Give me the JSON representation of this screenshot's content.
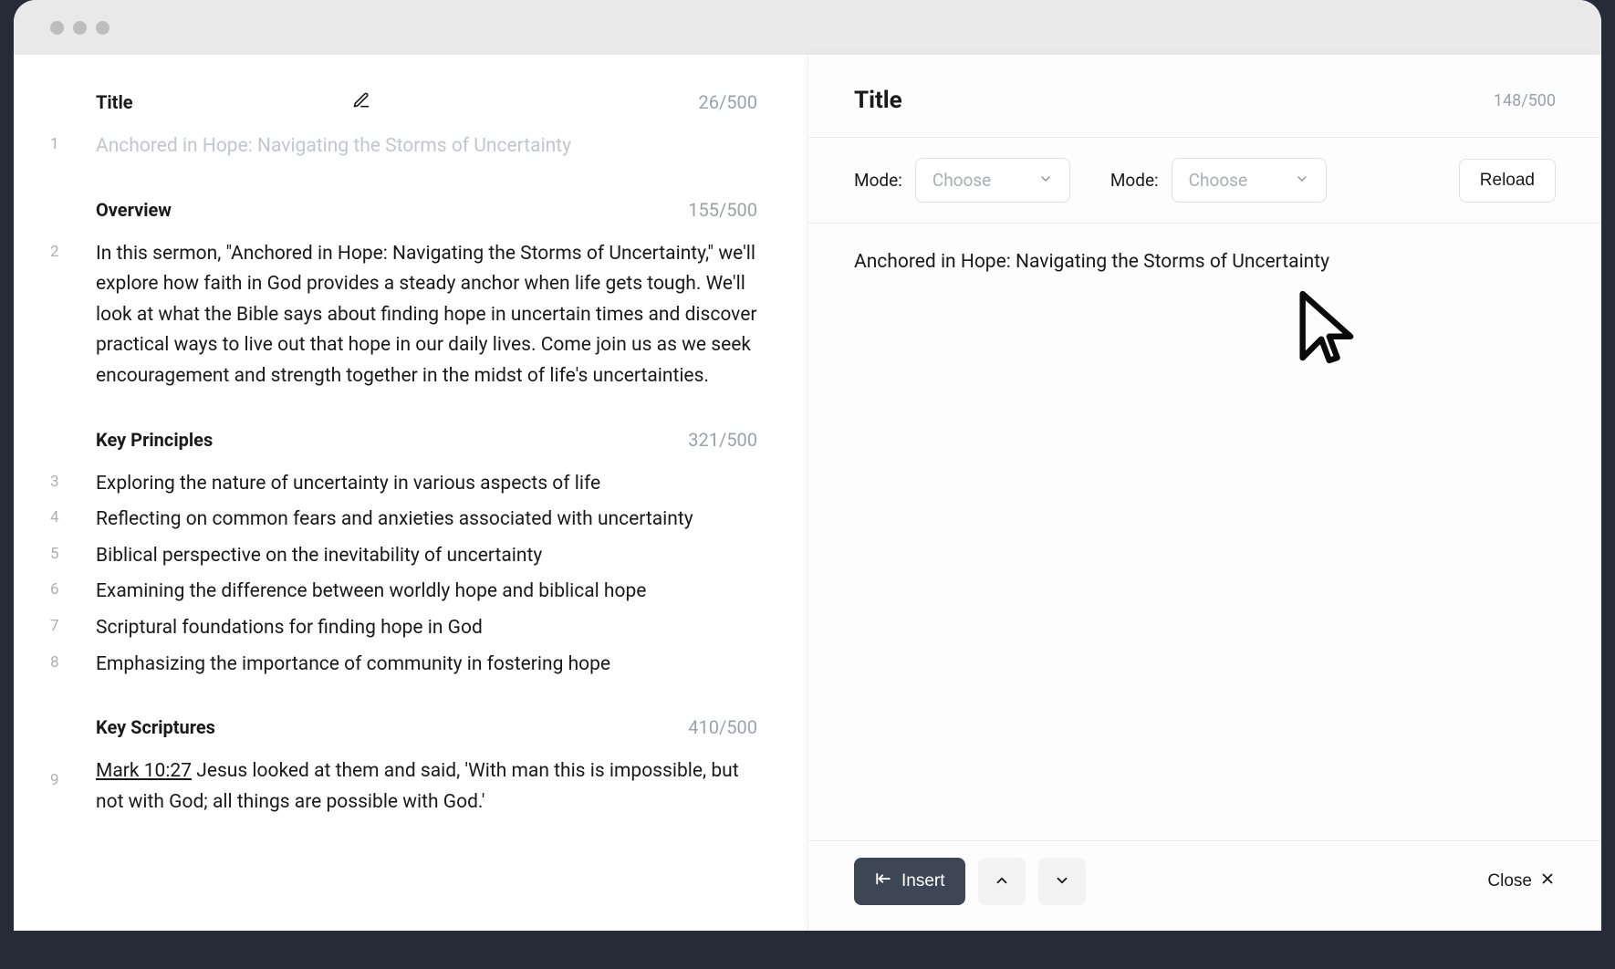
{
  "left": {
    "sections": {
      "title": {
        "heading": "Title",
        "count": "26/500"
      },
      "overview": {
        "heading": "Overview",
        "count": "155/500"
      },
      "principles": {
        "heading": "Key Principles",
        "count": "321/500"
      },
      "scriptures": {
        "heading": "Key Scriptures",
        "count": "410/500"
      }
    },
    "lines": {
      "l1": "Anchored in Hope: Navigating the Storms of Uncertainty",
      "l2": "In this sermon, \"Anchored in Hope: Navigating the Storms of Uncertainty,\" we'll explore how faith in God provides a steady anchor when life gets tough. We'll look at what the Bible says about finding hope in uncertain times and discover practical ways to live out that hope in our daily lives. Come join us as we seek encouragement and strength together in the midst of life's uncertainties.",
      "l3": "Exploring the nature of uncertainty in various aspects of life",
      "l4": "Reflecting on common fears and anxieties associated with uncertainty",
      "l5": "Biblical perspective on the inevitability of uncertainty",
      "l6": "Examining the difference between worldly hope and biblical hope",
      "l7": "Scriptural foundations for finding hope in God",
      "l8": "Emphasizing the importance of community in fostering hope",
      "l9_ref": "Mark 10:27",
      "l9_rest": " Jesus looked at them and said, 'With man this is impossible, but not with God; all things are possible with God.'"
    }
  },
  "right": {
    "title": "Title",
    "count": "148/500",
    "mode_label": "Mode:",
    "select_placeholder": "Choose",
    "reload_label": "Reload",
    "body_text": "Anchored in Hope: Navigating the Storms of Uncertainty",
    "insert_label": "Insert",
    "close_label": "Close"
  }
}
